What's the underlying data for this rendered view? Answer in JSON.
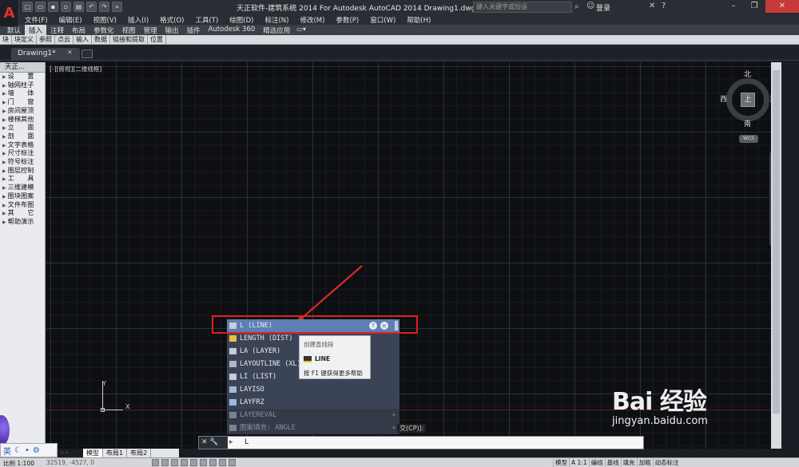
{
  "titlebar": {
    "logo": "A",
    "title": "天正软件-建筑系统 2014  For Autodesk AutoCAD 2014    Drawing1.dwg",
    "search_placeholder": "键入关键字或短语",
    "login": "登录"
  },
  "menu": [
    "文件(F)",
    "编辑(E)",
    "视图(V)",
    "插入(I)",
    "格式(O)",
    "工具(T)",
    "绘图(D)",
    "标注(N)",
    "修改(M)",
    "参数(P)",
    "窗口(W)",
    "帮助(H)"
  ],
  "ribbon_tabs": [
    {
      "label": "默认",
      "active": false
    },
    {
      "label": "插入",
      "active": true
    },
    {
      "label": "注释",
      "active": false
    },
    {
      "label": "布局",
      "active": false
    },
    {
      "label": "参数化",
      "active": false
    },
    {
      "label": "视图",
      "active": false
    },
    {
      "label": "管理",
      "active": false
    },
    {
      "label": "输出",
      "active": false
    },
    {
      "label": "插件",
      "active": false
    },
    {
      "label": "Autodesk 360",
      "active": false
    },
    {
      "label": "精选应用",
      "active": false
    }
  ],
  "ribbon_panels": [
    "块",
    "块定义",
    "参照",
    "点云",
    "输入",
    "数据",
    "链接和提取",
    "位置"
  ],
  "file_tab": {
    "name": "Drawing1*"
  },
  "left_palette": {
    "title": "天正...",
    "items": [
      "设　　置",
      "轴网柱子",
      "墙　　体",
      "门　　窗",
      "房间屋顶",
      "楼梯其他",
      "立　　面",
      "剖　　面",
      "文字表格",
      "尺寸标注",
      "符号标注",
      "图层控制",
      "工　　具",
      "三维建模",
      "图块图案",
      "文件布图",
      "其　　它",
      "帮助演示"
    ]
  },
  "viewport_label": "[-][俯视][二维线框]",
  "viewcube": {
    "north": "北",
    "south": "南",
    "west": "西",
    "east": "东",
    "face": "上",
    "wcs": "WCS"
  },
  "ucs": {
    "x": "X",
    "y": "Y"
  },
  "autocomplete": {
    "items": [
      {
        "label": "L (LINE)",
        "selected": true,
        "dim": false,
        "sub": ""
      },
      {
        "label": "LENGTH (DIST)",
        "selected": false,
        "dim": false,
        "sub": ""
      },
      {
        "label": "LA (LAYER)",
        "selected": false,
        "dim": false,
        "sub": ""
      },
      {
        "label": "LAYOUTLINE (XL)",
        "selected": false,
        "dim": false,
        "sub": ""
      },
      {
        "label": "LI (LIST)",
        "selected": false,
        "dim": false,
        "sub": ""
      },
      {
        "label": "LAYISO",
        "selected": false,
        "dim": false,
        "sub": ""
      },
      {
        "label": "LAYFRZ",
        "selected": false,
        "dim": false,
        "sub": ""
      },
      {
        "label": "LAYEREVAL",
        "selected": false,
        "dim": true,
        "sub": "+"
      },
      {
        "label": "图案填充: ANGLE",
        "selected": false,
        "dim": true,
        "sub": "+"
      }
    ],
    "tail": "交(CP)]:"
  },
  "tooltip": {
    "description": "创建直线段",
    "command": "LINE",
    "help": "按 F1 键获得更多帮助"
  },
  "command_line": {
    "left_icons": "✕ 🔧",
    "prompt_icon": "▸",
    "text": "L"
  },
  "layout_tabs": [
    {
      "label": "模型",
      "active": true
    },
    {
      "label": "布局1",
      "active": false
    },
    {
      "label": "布局2",
      "active": false
    }
  ],
  "statusbar": {
    "scale": "比例 1:100",
    "coords": "32519, -4527, 0",
    "right_items": [
      "模型",
      "A 1:1",
      "编组",
      "基线",
      "填充",
      "加粗",
      "动态标注"
    ]
  },
  "ime": {
    "lang": "英"
  },
  "watermark": {
    "main": "Bai 经验",
    "sub": "jingyan.baidu.com"
  },
  "colors": {
    "accent_red": "#e02020",
    "selected_item": "#5d7fb3",
    "canvas_bg": "#0d0f12"
  }
}
